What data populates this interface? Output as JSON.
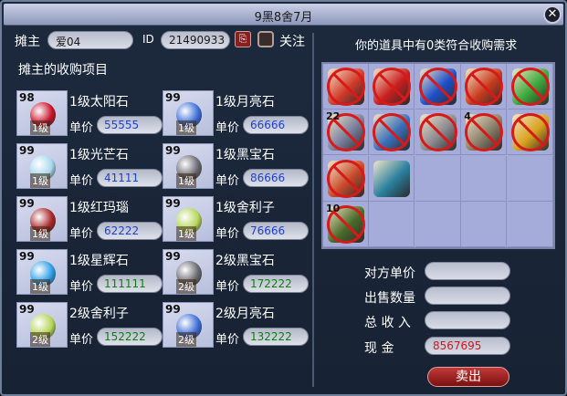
{
  "window": {
    "title": "9黑8舍7月"
  },
  "stall": {
    "owner_label": "摊主",
    "owner_name": "爱04",
    "id_label": "ID",
    "id_value": "21490933",
    "follow_label": "关注",
    "purchase_title": "摊主的收购项目"
  },
  "products": [
    {
      "qty": "98",
      "level": "1级",
      "name": "1级太阳石",
      "price_label": "单价",
      "price": "55555",
      "price_color": "#1f3fd1",
      "icon": "sun-stone-icon",
      "gem_color": "#c8142a"
    },
    {
      "qty": "99",
      "level": "1级",
      "name": "1级月亮石",
      "price_label": "单价",
      "price": "66666",
      "price_color": "#1f3fd1",
      "icon": "moon-stone-icon",
      "gem_color": "#3f6fd8"
    },
    {
      "qty": "99",
      "level": "1级",
      "name": "1级光芒石",
      "price_label": "单价",
      "price": "41111",
      "price_color": "#1f3fd1",
      "icon": "light-stone-icon",
      "gem_color": "#a8d8ee"
    },
    {
      "qty": "99",
      "level": "1级",
      "name": "1级黑宝石",
      "price_label": "单价",
      "price": "86666",
      "price_color": "#1f3fd1",
      "icon": "black-gem-icon",
      "gem_color": "#6a6a72"
    },
    {
      "qty": "99",
      "level": "1级",
      "name": "1级红玛瑙",
      "price_label": "单价",
      "price": "62222",
      "price_color": "#1f3fd1",
      "icon": "red-agate-icon",
      "gem_color": "#a8282a"
    },
    {
      "qty": "99",
      "level": "1级",
      "name": "1级舍利子",
      "price_label": "单价",
      "price": "76666",
      "price_color": "#1f3fd1",
      "icon": "sarira-icon",
      "gem_color": "#b6d65a"
    },
    {
      "qty": "99",
      "level": "1级",
      "name": "1级星辉石",
      "price_label": "单价",
      "price": "111111",
      "price_color": "#0e7d12",
      "icon": "star-stone-icon",
      "gem_color": "#2fa0e8"
    },
    {
      "qty": "99",
      "level": "2级",
      "name": "2级黑宝石",
      "price_label": "单价",
      "price": "172222",
      "price_color": "#0e7d12",
      "icon": "black-gem-icon",
      "gem_color": "#6a6a72"
    },
    {
      "qty": "99",
      "level": "2级",
      "name": "2级舍利子",
      "price_label": "单价",
      "price": "152222",
      "price_color": "#0e7d12",
      "icon": "sarira-icon",
      "gem_color": "#b6d65a"
    },
    {
      "qty": "99",
      "level": "2级",
      "name": "2级月亮石",
      "price_label": "单价",
      "price": "132222",
      "price_color": "#0e7d12",
      "icon": "moon-stone-icon",
      "gem_color": "#3f6fd8"
    }
  ],
  "inventory": {
    "header": "你的道具中有0类符合收购需求",
    "cells": [
      {
        "icon": "orb-item-icon",
        "color": "#d23a2a",
        "count": "",
        "blocked": true
      },
      {
        "icon": "flag-item-icon",
        "color": "#c81e1e",
        "count": "",
        "blocked": true
      },
      {
        "icon": "flag-item-icon",
        "color": "#1e4fc8",
        "count": "",
        "blocked": true
      },
      {
        "icon": "flag-item-icon",
        "color": "#c83a1e",
        "count": "",
        "blocked": true
      },
      {
        "icon": "flag-item-icon",
        "color": "#3ca83c",
        "count": "",
        "blocked": true
      },
      {
        "icon": "scroll-item-icon",
        "color": "#7a7f9e",
        "count": "22",
        "blocked": true
      },
      {
        "icon": "book-item-icon",
        "color": "#3a6fb8",
        "count": "",
        "blocked": true
      },
      {
        "icon": "dagger-item-icon",
        "color": "#8a8a90",
        "count": "",
        "blocked": true
      },
      {
        "icon": "shell-item-icon",
        "color": "#8a7f6a",
        "count": "4",
        "blocked": true
      },
      {
        "icon": "flag-item-icon",
        "color": "#d8a21e",
        "count": "",
        "blocked": true
      },
      {
        "icon": "orb-item-icon",
        "color": "#c84a2a",
        "count": "",
        "blocked": true
      },
      {
        "icon": "card-item-icon",
        "color": "#2a7f9e",
        "count": "",
        "blocked": false
      },
      {
        "icon": "empty",
        "color": "",
        "count": "",
        "blocked": false
      },
      {
        "icon": "empty",
        "color": "",
        "count": "",
        "blocked": false
      },
      {
        "icon": "empty",
        "color": "",
        "count": "",
        "blocked": false
      },
      {
        "icon": "talisman-item-icon",
        "color": "#4a6a2a",
        "count": "10",
        "blocked": true
      },
      {
        "icon": "empty",
        "color": "",
        "count": "",
        "blocked": false
      },
      {
        "icon": "empty",
        "color": "",
        "count": "",
        "blocked": false
      },
      {
        "icon": "empty",
        "color": "",
        "count": "",
        "blocked": false
      },
      {
        "icon": "empty",
        "color": "",
        "count": "",
        "blocked": false
      }
    ]
  },
  "trade": {
    "unit_price_label": "对方单价",
    "unit_price_value": "",
    "quantity_label": "出售数量",
    "quantity_value": "",
    "total_label": "总 收 入",
    "total_value": "",
    "cash_label": "现      金",
    "cash_value": "8567695",
    "cash_color": "#d01818",
    "sell_label": "卖出"
  }
}
